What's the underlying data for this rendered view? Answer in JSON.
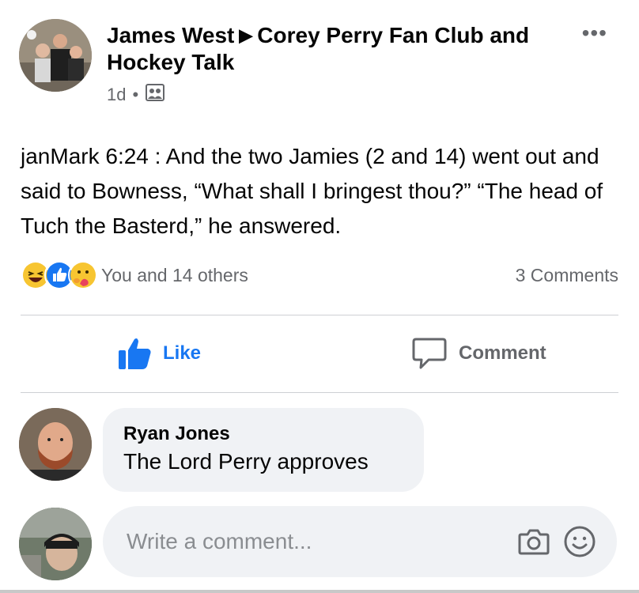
{
  "post": {
    "author": "James West",
    "group": "Corey Perry Fan Club and Hockey Talk",
    "arrow": "▶",
    "time": "1d",
    "dot": "•",
    "audience_icon": "group-audience-icon",
    "more": "•••",
    "body": "janMark 6:24 :  And the two Jamies (2 and 14) went out and said to Bowness, “What shall I bringest thou?” “The head of Tuch the Basterd,” he answered."
  },
  "reactions": {
    "icons": [
      "laugh-react-icon",
      "like-react-icon",
      "care-react-icon"
    ],
    "summary": "You and 14 others",
    "comments_count": "3 Comments"
  },
  "actions": {
    "like_label": "Like",
    "comment_label": "Comment",
    "like_color": "#1877f2"
  },
  "comments": [
    {
      "author": "Ryan Jones",
      "text": "The Lord Perry approves"
    }
  ],
  "composer": {
    "placeholder": "Write a comment...",
    "icons": [
      "camera-icon",
      "emoji-icon"
    ]
  }
}
